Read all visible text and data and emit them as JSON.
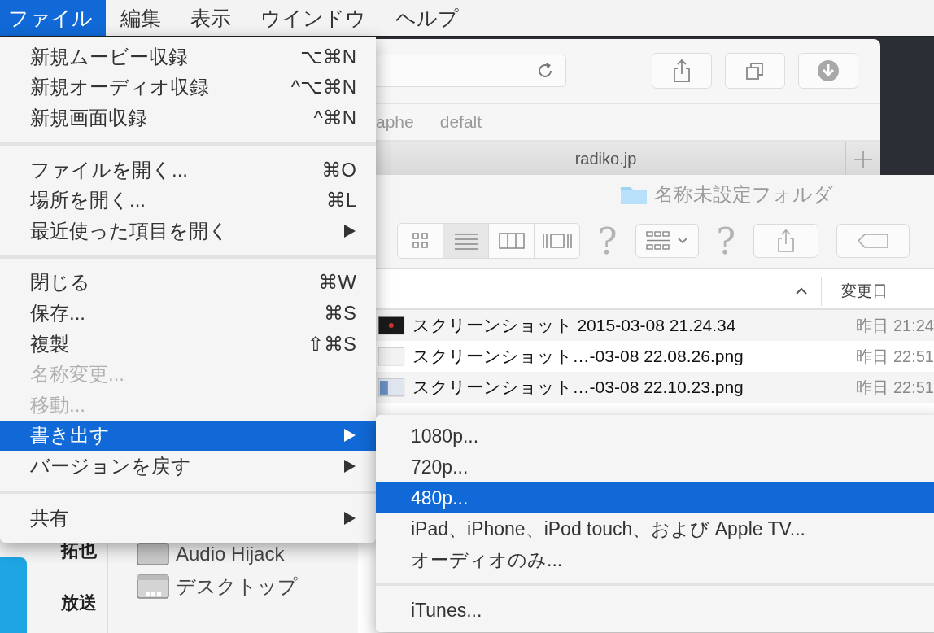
{
  "menubar": {
    "items": [
      {
        "label": "ファイル",
        "selected": true
      },
      {
        "label": "編集",
        "selected": false
      },
      {
        "label": "表示",
        "selected": false
      },
      {
        "label": "ウインドウ",
        "selected": false
      },
      {
        "label": "ヘルプ",
        "selected": false
      }
    ]
  },
  "browser": {
    "bookmarks": [
      "aphe",
      "defalt"
    ],
    "tab_title": "radiko.jp",
    "toolbar": [
      {
        "kind": "share"
      },
      {
        "kind": "tabs"
      },
      {
        "kind": "download"
      }
    ]
  },
  "finder": {
    "title": "名称未設定フォルダ",
    "toolbar": [
      {
        "kind": "view_switch"
      },
      {
        "kind": "unknown",
        "label": "?"
      },
      {
        "kind": "arrange"
      },
      {
        "kind": "unknown",
        "label": "?"
      },
      {
        "kind": "share"
      },
      {
        "kind": "tag"
      }
    ],
    "view_modes": [
      {
        "kind": "icons",
        "selected": false
      },
      {
        "kind": "list",
        "selected": true
      },
      {
        "kind": "columns",
        "selected": false
      },
      {
        "kind": "coverflow",
        "selected": false
      }
    ],
    "columns": [
      {
        "label": "変更日"
      }
    ],
    "rows": [
      {
        "name": "スクリーンショット 2015-03-08 21.24.34",
        "date": "昨日 21:24",
        "kind": "dark"
      },
      {
        "name": "スクリーンショット…-03-08 22.08.26.png",
        "date": "昨日 22:51",
        "kind": "light"
      },
      {
        "name": "スクリーンショット…-03-08 22.10.23.png",
        "date": "昨日 22:51",
        "kind": "window"
      }
    ],
    "sidebar": [
      {
        "label": "Audio Hijack",
        "kind": "disk"
      },
      {
        "label": "デスクトップ",
        "kind": "desktop"
      }
    ]
  },
  "back_window": {
    "texts": [
      "拓也",
      "放送"
    ]
  },
  "file_menu": {
    "sections": [
      {
        "items": [
          {
            "label": "新規ムービー収録",
            "shortcut": "⌥⌘N",
            "submenu": false,
            "disabled": false,
            "selected": false
          },
          {
            "label": "新規オーディオ収録",
            "shortcut": "^⌥⌘N",
            "submenu": false,
            "disabled": false,
            "selected": false
          },
          {
            "label": "新規画面収録",
            "shortcut": "^⌘N",
            "submenu": false,
            "disabled": false,
            "selected": false
          }
        ]
      },
      {
        "items": [
          {
            "label": "ファイルを開く...",
            "shortcut": "⌘O",
            "submenu": false,
            "disabled": false,
            "selected": false
          },
          {
            "label": "場所を開く...",
            "shortcut": "⌘L",
            "submenu": false,
            "disabled": false,
            "selected": false
          },
          {
            "label": "最近使った項目を開く",
            "submenu": true,
            "disabled": false,
            "selected": false
          }
        ]
      },
      {
        "items": [
          {
            "label": "閉じる",
            "shortcut": "⌘W",
            "submenu": false,
            "disabled": false,
            "selected": false
          },
          {
            "label": "保存...",
            "shortcut": "⌘S",
            "submenu": false,
            "disabled": false,
            "selected": false
          },
          {
            "label": "複製",
            "shortcut": "⇧⌘S",
            "submenu": false,
            "disabled": false,
            "selected": false
          },
          {
            "label": "名称変更...",
            "submenu": false,
            "disabled": true,
            "selected": false
          },
          {
            "label": "移動...",
            "submenu": false,
            "disabled": true,
            "selected": false
          },
          {
            "label": "書き出す",
            "submenu": true,
            "disabled": false,
            "selected": true
          },
          {
            "label": "バージョンを戻す",
            "submenu": true,
            "disabled": false,
            "selected": false
          }
        ]
      },
      {
        "items": [
          {
            "label": "共有",
            "submenu": true,
            "disabled": false,
            "selected": false
          }
        ]
      }
    ]
  },
  "export_submenu": {
    "sections": [
      {
        "items": [
          {
            "label": "1080p...",
            "selected": false
          },
          {
            "label": "720p...",
            "selected": false
          },
          {
            "label": "480p...",
            "selected": true
          },
          {
            "label": "iPad、iPhone、iPod touch、および Apple TV...",
            "selected": false
          },
          {
            "label": "オーディオのみ...",
            "selected": false
          }
        ]
      },
      {
        "items": [
          {
            "label": "iTunes...",
            "selected": false
          }
        ]
      }
    ]
  }
}
